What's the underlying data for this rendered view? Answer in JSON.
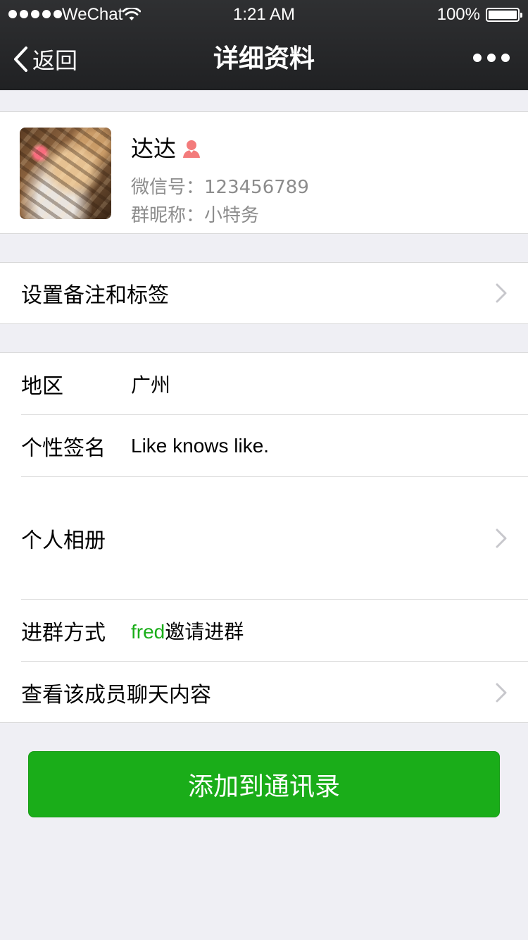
{
  "status_bar": {
    "carrier": "WeChat",
    "time": "1:21 AM",
    "battery": "100%"
  },
  "nav": {
    "back_label": "返回",
    "title": "详细资料"
  },
  "profile": {
    "name": "达达",
    "wechat_id": "微信号：123456789",
    "group_nickname": "群昵称：小特务"
  },
  "remark_row": {
    "label": "设置备注和标签"
  },
  "info": {
    "region_label": "地区",
    "region_value": "广州",
    "signature_label": "个性签名",
    "signature_value": "Like knows like.",
    "album_label": "个人相册",
    "join_label": "进群方式",
    "join_inviter": "fred",
    "join_suffix": "邀请进群",
    "chat_history_label": "查看该成员聊天内容"
  },
  "actions": {
    "add_contact": "添加到通讯录"
  },
  "colors": {
    "accent_green": "#1aad19",
    "female_icon": "#f37b7b"
  }
}
